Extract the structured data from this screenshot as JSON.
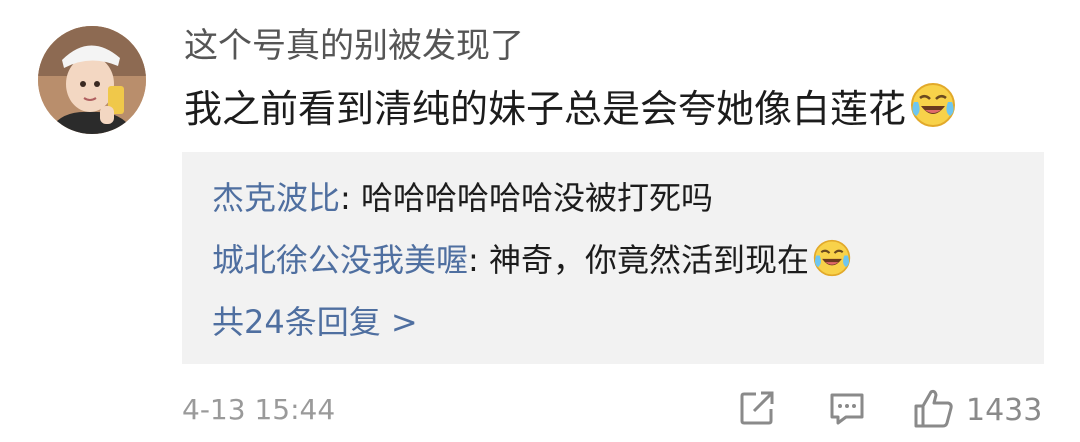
{
  "comment": {
    "avatar_icon": "user-avatar-photo",
    "username": "这个号真的别被发现了",
    "text": "我之前看到清纯的妹子总是会夸她像白莲花",
    "text_emoji": "laughing-crying-emoji",
    "replies": [
      {
        "author": "杰克波比",
        "separator": ": ",
        "text": "哈哈哈哈哈哈没被打死吗"
      },
      {
        "author": "城北徐公没我美喔",
        "separator": ": ",
        "text": "神奇，你竟然活到现在",
        "emoji": "laughing-crying-emoji"
      }
    ],
    "more_replies": "共24条回复 >",
    "timestamp": "4-13 15:44",
    "actions": {
      "share_icon": "share-icon",
      "comment_icon": "comment-icon",
      "like_icon": "thumbs-up-icon",
      "like_count": "1433"
    },
    "colors": {
      "link": "#4f6fa0",
      "reply_background": "#f2f2f2",
      "meta": "#9a9a9a"
    }
  }
}
